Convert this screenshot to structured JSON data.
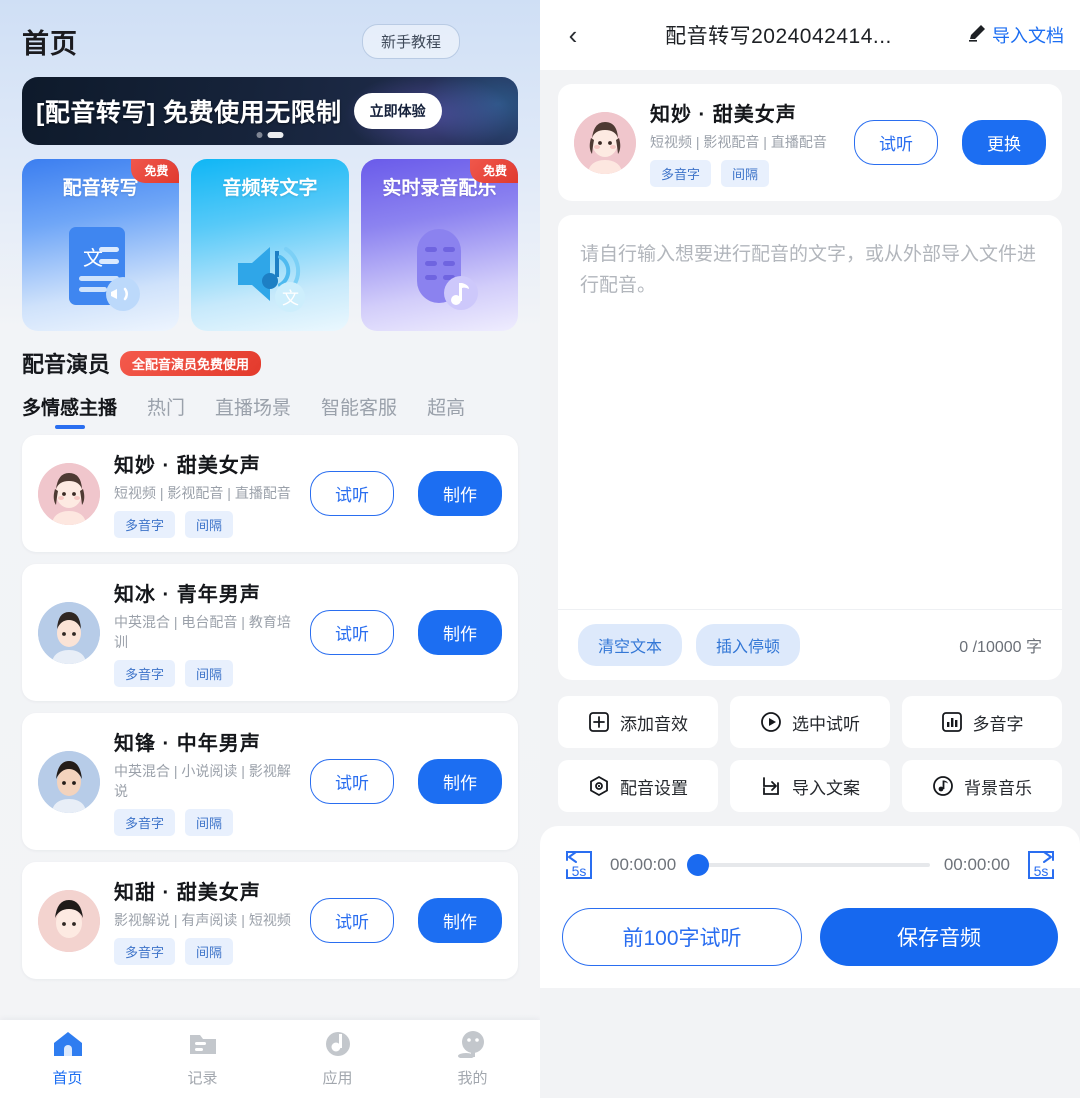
{
  "left": {
    "header": {
      "title": "首页",
      "tutorial": "新手教程"
    },
    "banner": {
      "text": "[配音转写] 免费使用无限制",
      "button": "立即体验"
    },
    "feature_cards": [
      {
        "label": "配音转写",
        "badge": "免费",
        "icon": "document-sound-icon"
      },
      {
        "label": "音频转文字",
        "badge": "",
        "icon": "speaker-text-icon"
      },
      {
        "label": "实时录音配乐",
        "badge": "免费",
        "icon": "microphone-music-icon"
      }
    ],
    "section": {
      "title": "配音演员",
      "badge": "全配音演员免费使用"
    },
    "tabs": [
      {
        "label": "多情感主播",
        "active": true
      },
      {
        "label": "热门",
        "active": false
      },
      {
        "label": "直播场景",
        "active": false
      },
      {
        "label": "智能客服",
        "active": false
      },
      {
        "label": "超高",
        "active": false
      }
    ],
    "actors": [
      {
        "name": "知妙 · 甜美女声",
        "tags": "短视频 | 影视配音 | 直播配音",
        "chips": [
          "多音字",
          "间隔"
        ],
        "listen": "试听",
        "make": "制作",
        "avatar": "female"
      },
      {
        "name": "知冰 · 青年男声",
        "tags": "中英混合 | 电台配音 | 教育培训",
        "chips": [
          "多音字",
          "间隔"
        ],
        "listen": "试听",
        "make": "制作",
        "avatar": "male"
      },
      {
        "name": "知锋 · 中年男声",
        "tags": "中英混合 | 小说阅读 | 影视解说",
        "chips": [
          "多音字",
          "间隔"
        ],
        "listen": "试听",
        "make": "制作",
        "avatar": "male"
      },
      {
        "name": "知甜 · 甜美女声",
        "tags": "影视解说 | 有声阅读 | 短视频",
        "chips": [
          "多音字",
          "间隔"
        ],
        "listen": "试听",
        "make": "制作",
        "avatar": "female"
      }
    ],
    "bottom_nav": [
      {
        "label": "首页",
        "icon": "home-icon",
        "active": true
      },
      {
        "label": "记录",
        "icon": "records-icon",
        "active": false
      },
      {
        "label": "应用",
        "icon": "apps-icon",
        "active": false
      },
      {
        "label": "我的",
        "icon": "profile-icon",
        "active": false
      }
    ]
  },
  "right": {
    "header": {
      "back": "‹",
      "title": "配音转写2024042414...",
      "import_doc": "导入文档",
      "edit_icon": "pencil-icon"
    },
    "voice": {
      "name": "知妙 · 甜美女声",
      "tags": "短视频 | 影视配音 | 直播配音",
      "chips": [
        "多音字",
        "间隔"
      ],
      "listen": "试听",
      "change": "更换"
    },
    "editor": {
      "placeholder": "请自行输入想要进行配音的文字，或从外部导入文件进行配音。",
      "clear": "清空文本",
      "pause": "插入停顿",
      "count_current": "0",
      "count_total": "/10000 字"
    },
    "functions": [
      {
        "label": "添加音效",
        "icon": "plus-square-icon"
      },
      {
        "label": "选中试听",
        "icon": "play-circle-icon"
      },
      {
        "label": "多音字",
        "icon": "bar-chart-square-icon"
      },
      {
        "label": "配音设置",
        "icon": "hexagon-gear-icon"
      },
      {
        "label": "导入文案",
        "icon": "import-arrow-icon"
      },
      {
        "label": "背景音乐",
        "icon": "music-circle-icon"
      }
    ],
    "player": {
      "skip_back": "5s",
      "skip_forward": "5s",
      "current_time": "00:00:00",
      "total_time": "00:00:00",
      "progress_percent": 0
    },
    "cta": {
      "preview": "前100字试听",
      "save": "保存音频"
    }
  },
  "colors": {
    "accent": "#1c6ef2",
    "accent_light": "#2a6ef0",
    "badge_red": "#e33a2c",
    "chip_bg": "#e8f0fd",
    "muted": "#9ba1aa"
  }
}
